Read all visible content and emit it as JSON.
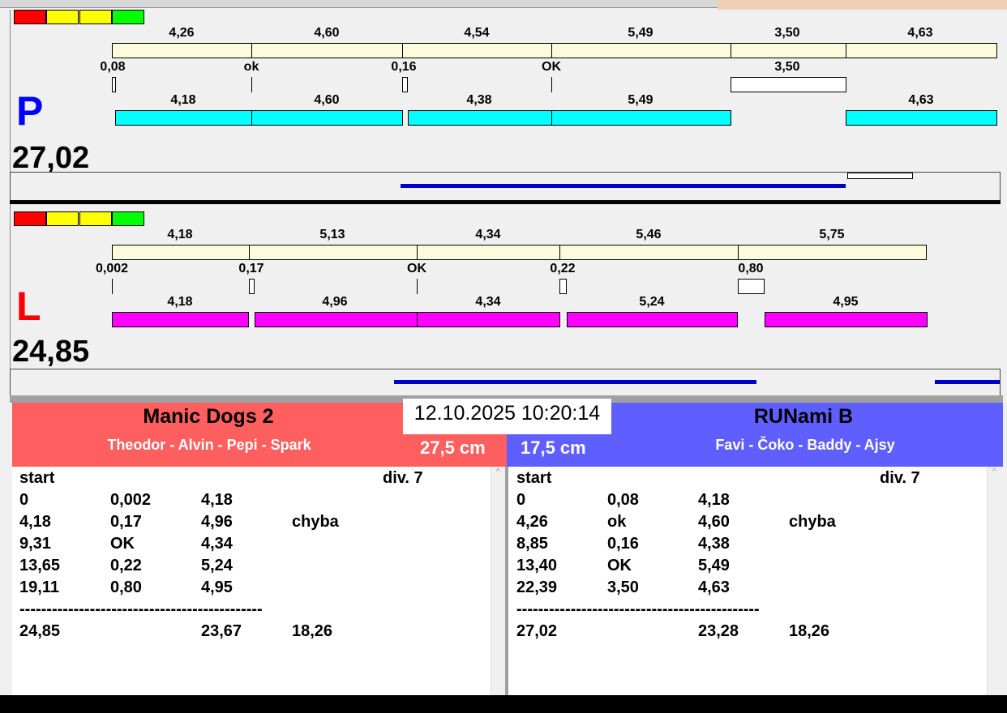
{
  "colors": {
    "red": "#ff0000",
    "yellow": "#ffff00",
    "green": "#00ff00",
    "cyan": "#00ffff",
    "magenta": "#ff00ff",
    "team_left": "#ff5f5f",
    "team_right": "#5f5fff",
    "line": "#0000cc"
  },
  "p": {
    "letter": "P",
    "total": "27,02",
    "top_labels": [
      "4,26",
      "4,60",
      "4,54",
      "5,49",
      "3,50",
      "4,63"
    ],
    "mid_labels": [
      "0,08",
      "ok",
      "0,16",
      "OK",
      "3,50"
    ],
    "bottom_labels": [
      "4,18",
      "4,60",
      "4,38",
      "5,49",
      "4,63"
    ]
  },
  "l": {
    "letter": "L",
    "total": "24,85",
    "top_labels": [
      "4,18",
      "5,13",
      "4,34",
      "5,46",
      "5,75"
    ],
    "mid_labels": [
      "0,002",
      "0,17",
      "OK",
      "0,22",
      "0,80"
    ],
    "bottom_labels": [
      "4,18",
      "4,96",
      "4,34",
      "5,24",
      "4,95"
    ]
  },
  "datetime": "12.10.2025 10:20:14",
  "left_team": {
    "name": "Manic Dogs 2",
    "members": "Theodor - Alvin - Pepi - Spark",
    "height": "27,5 cm",
    "start": "start",
    "div": "div.  7",
    "rows": [
      [
        "0",
        "0,002",
        "4,18",
        ""
      ],
      [
        "4,18",
        "0,17",
        "4,96",
        "chyba"
      ],
      [
        "9,31",
        "OK",
        "4,34",
        ""
      ],
      [
        "13,65",
        "0,22",
        "5,24",
        ""
      ],
      [
        "19,11",
        "0,80",
        "4,95",
        ""
      ]
    ],
    "separator": "---------------------------------------------",
    "totals": [
      "24,85",
      "",
      "23,67",
      "18,26"
    ]
  },
  "right_team": {
    "name": "RUNami B",
    "members": "Favi - Čoko - Baddy - Ajsy",
    "height": "17,5 cm",
    "start": "start",
    "div": "div.  7",
    "rows": [
      [
        "0",
        "0,08",
        "4,18",
        ""
      ],
      [
        "4,26",
        "ok",
        "4,60",
        "chyba"
      ],
      [
        "8,85",
        "0,16",
        "4,38",
        ""
      ],
      [
        "13,40",
        "OK",
        "5,49",
        ""
      ],
      [
        "22,39",
        "3,50",
        "4,63",
        ""
      ]
    ],
    "separator": "---------------------------------------------",
    "totals": [
      "27,02",
      "",
      "23,28",
      "18,26"
    ]
  }
}
